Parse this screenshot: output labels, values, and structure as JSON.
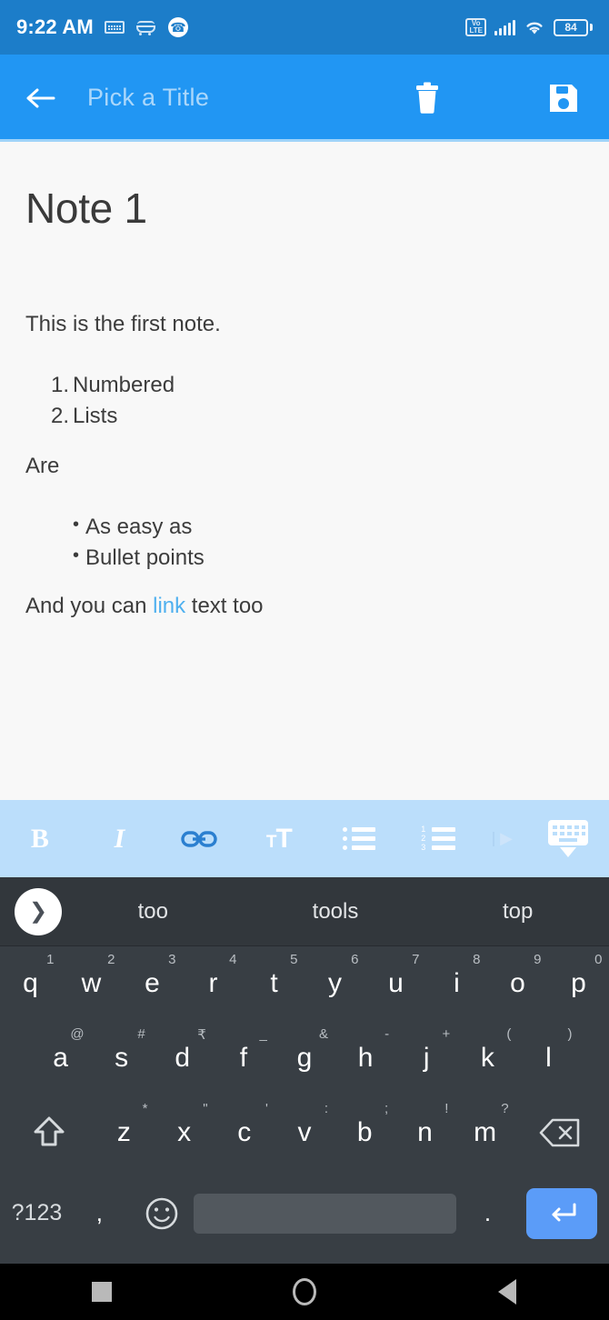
{
  "statusbar": {
    "time": "9:22 AM",
    "icons_left": [
      "keyboard-icon",
      "amazon-cart-icon",
      "phone-icon"
    ],
    "volte_label_top": "Vo",
    "volte_label_bottom": "LTE",
    "icons_right": [
      "volte-icon",
      "signal-icon",
      "wifi-icon",
      "battery-icon"
    ],
    "battery_level": "84"
  },
  "appbar": {
    "back_icon": "arrow-left-icon",
    "title_placeholder": "Pick a Title",
    "delete_icon": "trash-icon",
    "save_icon": "save-floppy-icon",
    "background": "#2196f3"
  },
  "note": {
    "title": "Note 1",
    "paragraph_first": "This is the first note.",
    "numbered_list": [
      {
        "marker": "1.",
        "text": "Numbered"
      },
      {
        "marker": "2.",
        "text": "Lists"
      }
    ],
    "paragraph_are": "Are",
    "bullet_list": [
      {
        "marker": "•",
        "text": "As easy as"
      },
      {
        "marker": "•",
        "text": "Bullet points"
      }
    ],
    "link_line": {
      "before": "And you can ",
      "link": "link",
      "after": " text too",
      "link_color": "#4fb0ef"
    }
  },
  "format_toolbar": {
    "background": "#bbdefb",
    "active_color": "#2a7fd0",
    "items": [
      {
        "name": "bold-icon",
        "label": "B"
      },
      {
        "name": "italic-icon",
        "label": "I"
      },
      {
        "name": "link-icon",
        "label": ""
      },
      {
        "name": "text-size-icon",
        "label": "TT"
      },
      {
        "name": "bullet-list-icon",
        "label": ""
      },
      {
        "name": "numbered-list-icon",
        "label": ""
      },
      {
        "name": "overflow-arrow-icon",
        "label": ""
      },
      {
        "name": "hide-keyboard-icon",
        "label": ""
      }
    ]
  },
  "keyboard": {
    "expand_icon": "chevron-right-icon",
    "suggestions": [
      "too",
      "tools",
      "top"
    ],
    "row1": [
      {
        "key": "q",
        "sup": "1"
      },
      {
        "key": "w",
        "sup": "2"
      },
      {
        "key": "e",
        "sup": "3"
      },
      {
        "key": "r",
        "sup": "4"
      },
      {
        "key": "t",
        "sup": "5"
      },
      {
        "key": "y",
        "sup": "6"
      },
      {
        "key": "u",
        "sup": "7"
      },
      {
        "key": "i",
        "sup": "8"
      },
      {
        "key": "o",
        "sup": "9"
      },
      {
        "key": "p",
        "sup": "0"
      }
    ],
    "row2": [
      {
        "key": "a",
        "sup": "@"
      },
      {
        "key": "s",
        "sup": "#"
      },
      {
        "key": "d",
        "sup": "₹"
      },
      {
        "key": "f",
        "sup": "_"
      },
      {
        "key": "g",
        "sup": "&"
      },
      {
        "key": "h",
        "sup": "-"
      },
      {
        "key": "j",
        "sup": "+"
      },
      {
        "key": "k",
        "sup": "("
      },
      {
        "key": "l",
        "sup": ")"
      }
    ],
    "row3": [
      {
        "key": "z",
        "sup": "*"
      },
      {
        "key": "x",
        "sup": "\""
      },
      {
        "key": "c",
        "sup": "'"
      },
      {
        "key": "v",
        "sup": ":"
      },
      {
        "key": "b",
        "sup": ";"
      },
      {
        "key": "n",
        "sup": "!"
      },
      {
        "key": "m",
        "sup": "?"
      }
    ],
    "shift_icon": "shift-up-arrow-icon",
    "backspace_icon": "backspace-icon",
    "symbols_key": "?123",
    "comma_key": ",",
    "emoji_icon": "emoji-smiley-icon",
    "space_key": "",
    "period_key": ".",
    "enter_icon": "enter-return-icon",
    "enter_color": "#5b9cf8"
  },
  "navbar": {
    "recents_icon": "square-recents-icon",
    "home_icon": "circle-home-icon",
    "back_icon": "triangle-back-icon"
  }
}
